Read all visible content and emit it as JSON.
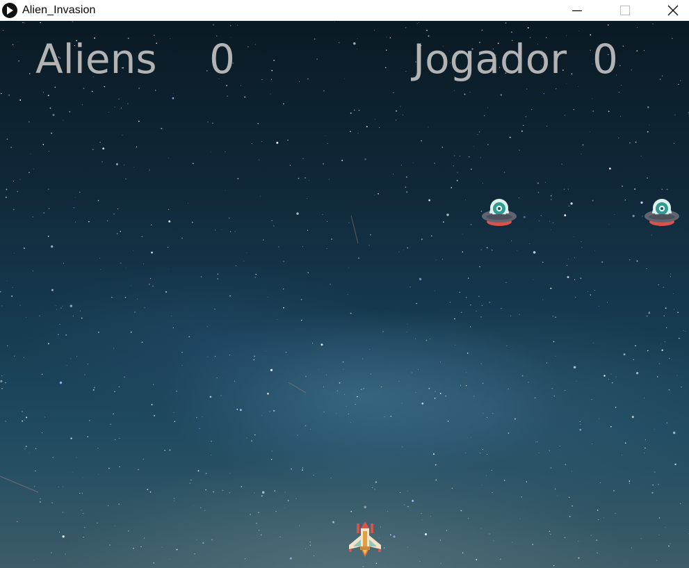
{
  "window": {
    "title": "Alien_Invasion",
    "icon": "play-circle-icon",
    "controls": [
      "minimize-icon",
      "maximize-icon",
      "close-icon"
    ]
  },
  "hud": {
    "aliens_label": "Aliens",
    "aliens_score": "0",
    "player_label": "Jogador",
    "player_score": "0"
  },
  "sprites": {
    "aliens": [
      {
        "icon": "ufo-alien-icon"
      },
      {
        "icon": "ufo-alien-icon"
      }
    ],
    "player": {
      "icon": "rocket-ship-icon"
    }
  },
  "colors": {
    "hud_text": "#b3b3b3",
    "sky_top": "#0a1a24",
    "sky_bottom": "#3c5c68"
  }
}
